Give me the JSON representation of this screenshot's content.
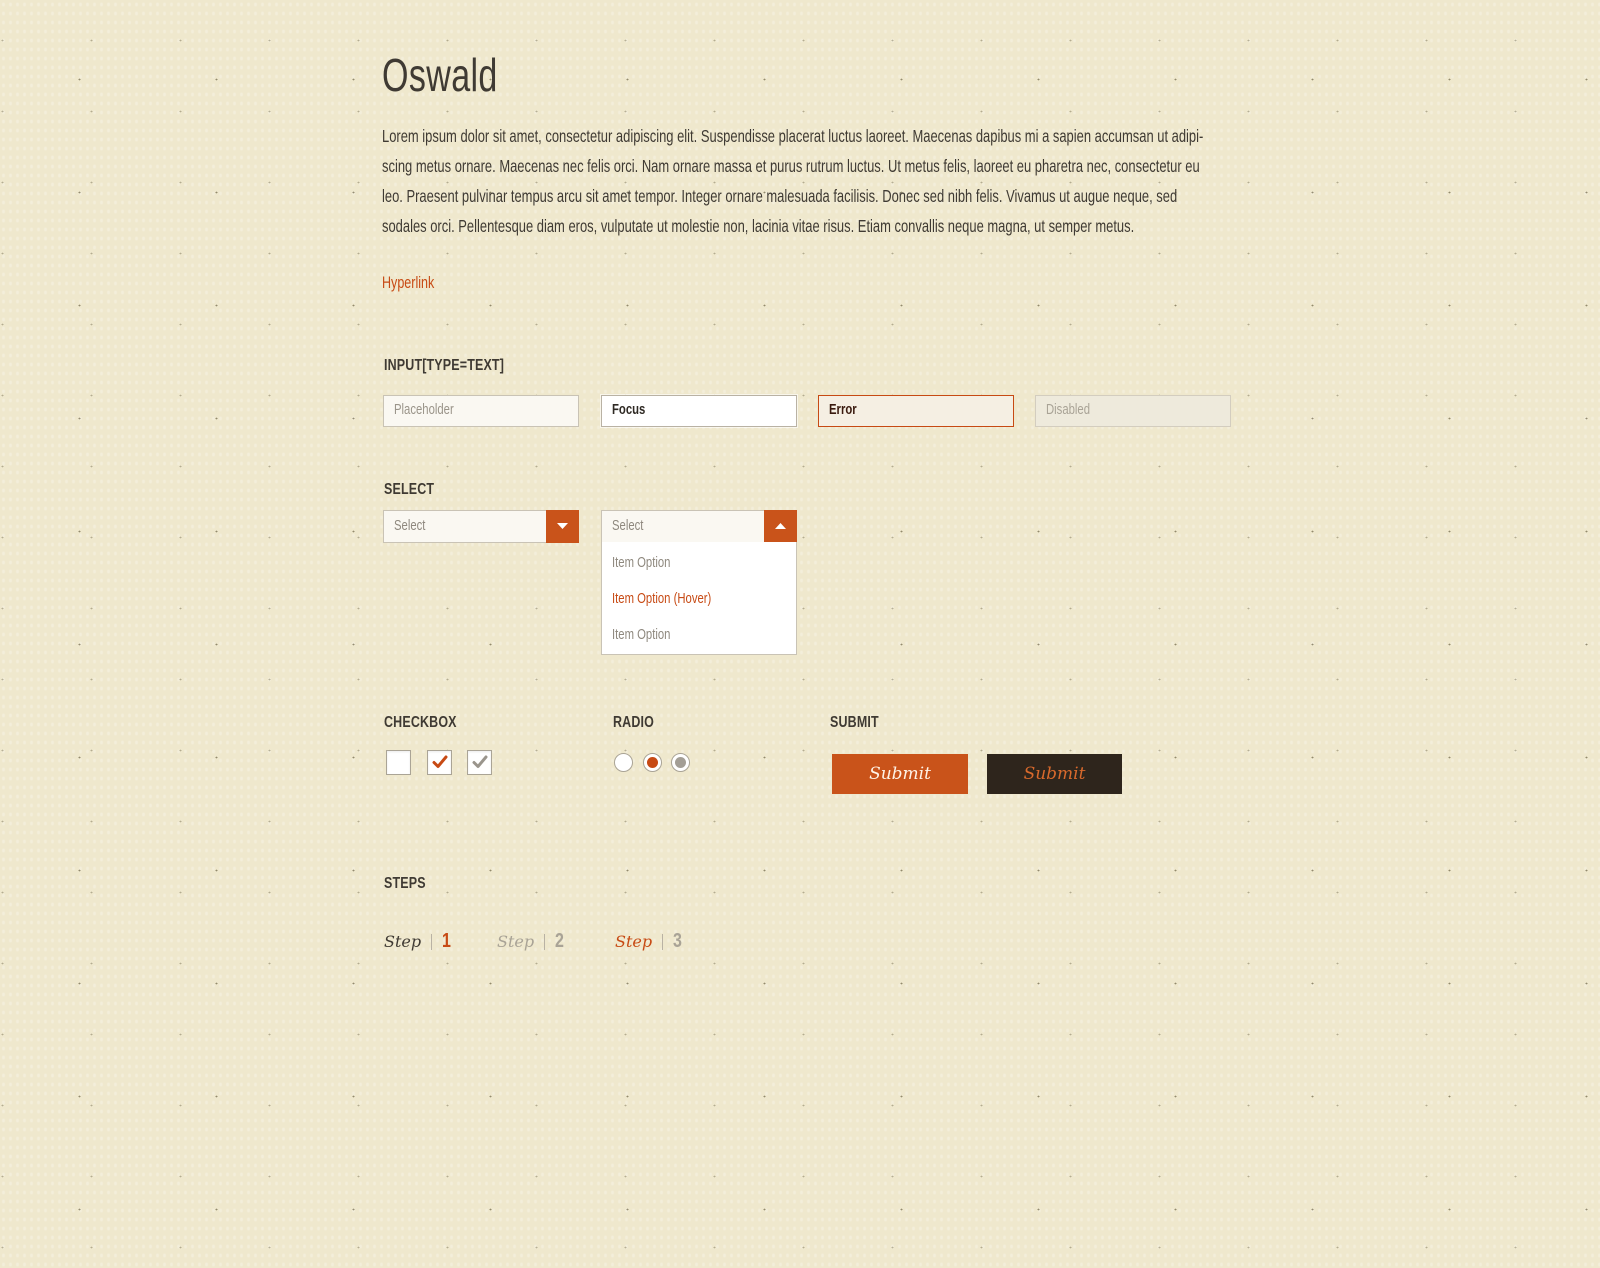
{
  "title": "Oswald",
  "lead": "Lorem ipsum dolor sit amet, consectetur adipiscing elit. Suspendisse placerat luctus laoreet. Maecenas dapibus mi a sapien accumsan ut adipi-scing metus ornare. Maecenas nec felis orci. Nam ornare massa et purus rutrum luctus. Ut metus felis, laoreet eu pharetra nec, consectetur eu leo. Praesent pulvinar tempus arcu sit amet tempor. Integer ornare malesuada facilisis. Donec sed nibh felis. Vivamus ut augue neque, sed sodales orci. Pellentesque diam eros, vulputate ut molestie non, lacinia vitae risus. Etiam convallis neque magna, ut semper metus.",
  "hyperlink": "Hyperlink",
  "inputs": {
    "label": "INPUT[TYPE=TEXT]",
    "placeholder": "Placeholder",
    "focus": "Focus",
    "error": "Error",
    "disabled": "Disabled"
  },
  "select": {
    "label": "SELECT",
    "closed_value": "Select",
    "open_value": "Select",
    "options": [
      "Item Option",
      "Item Option (Hover)",
      "Item Option"
    ]
  },
  "checkbox": {
    "label": "CHECKBOX",
    "states": [
      "unchecked",
      "checked",
      "checked-disabled"
    ]
  },
  "radio": {
    "label": "RADIO",
    "states": [
      "unselected",
      "selected",
      "selected-disabled"
    ]
  },
  "submit": {
    "label": "SUBMIT",
    "primary": "Submit",
    "secondary": "Submit"
  },
  "steps": {
    "label": "STEPS",
    "items": [
      {
        "word": "Step",
        "num": "1"
      },
      {
        "word": "Step",
        "num": "2"
      },
      {
        "word": "Step",
        "num": "3"
      }
    ]
  },
  "colors": {
    "background": "#efe8cd",
    "accent": "#c9531a",
    "text": "#3f3a33",
    "dark": "#2e251c",
    "muted": "#a9a396"
  },
  "icons": {
    "select_closed": "caret-down-icon",
    "select_open": "caret-up-icon",
    "check": "checkmark-icon"
  }
}
